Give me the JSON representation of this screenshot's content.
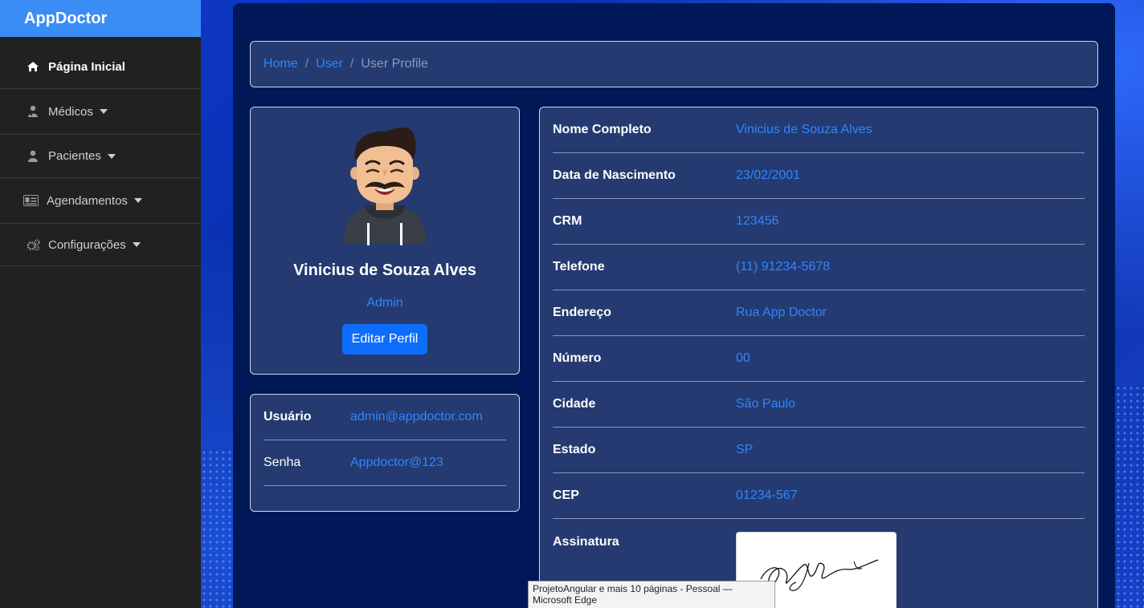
{
  "app": {
    "brand": "AppDoctor"
  },
  "sidebar": {
    "items": [
      {
        "label": "Página Inicial",
        "icon": "home-icon",
        "active": true
      },
      {
        "label": "Médicos",
        "icon": "doctor-icon",
        "dropdown": true
      },
      {
        "label": "Pacientes",
        "icon": "user-icon",
        "dropdown": true
      },
      {
        "label": "Agendamentos",
        "icon": "id-card-icon",
        "dropdown": true
      },
      {
        "label": "Configurações",
        "icon": "gears-icon",
        "dropdown": true
      }
    ]
  },
  "breadcrumb": {
    "home": "Home",
    "user": "User",
    "current": "User Profile",
    "separator": "/"
  },
  "profile": {
    "name": "Vinicius de Souza Alves",
    "role": "Admin",
    "edit_label": "Editar Perfil"
  },
  "credentials": {
    "user_label": "Usuário",
    "user_value": "admin@appdoctor.com",
    "password_label": "Senha",
    "password_value": "Appdoctor@123"
  },
  "details": [
    {
      "label": "Nome Completo",
      "value": "Vinicius de Souza Alves"
    },
    {
      "label": "Data de Nascimento",
      "value": "23/02/2001"
    },
    {
      "label": "CRM",
      "value": "123456"
    },
    {
      "label": "Telefone",
      "value": "(11) 91234-5678"
    },
    {
      "label": "Endereço",
      "value": "Rua App Doctor"
    },
    {
      "label": "Número",
      "value": "00"
    },
    {
      "label": "Cidade",
      "value": "São Paulo"
    },
    {
      "label": "Estado",
      "value": "SP"
    },
    {
      "label": "CEP",
      "value": "01234-567"
    },
    {
      "label": "Assinatura",
      "value": ""
    }
  ],
  "tooltip": {
    "text": "ProjetoAngular e mais 10 páginas - Pessoal — Microsoft Edge"
  },
  "colors": {
    "accent": "#2f86ff",
    "brand": "#3b8df6",
    "button": "#0d6efd",
    "panel": "#001758",
    "card": "#243a70"
  }
}
